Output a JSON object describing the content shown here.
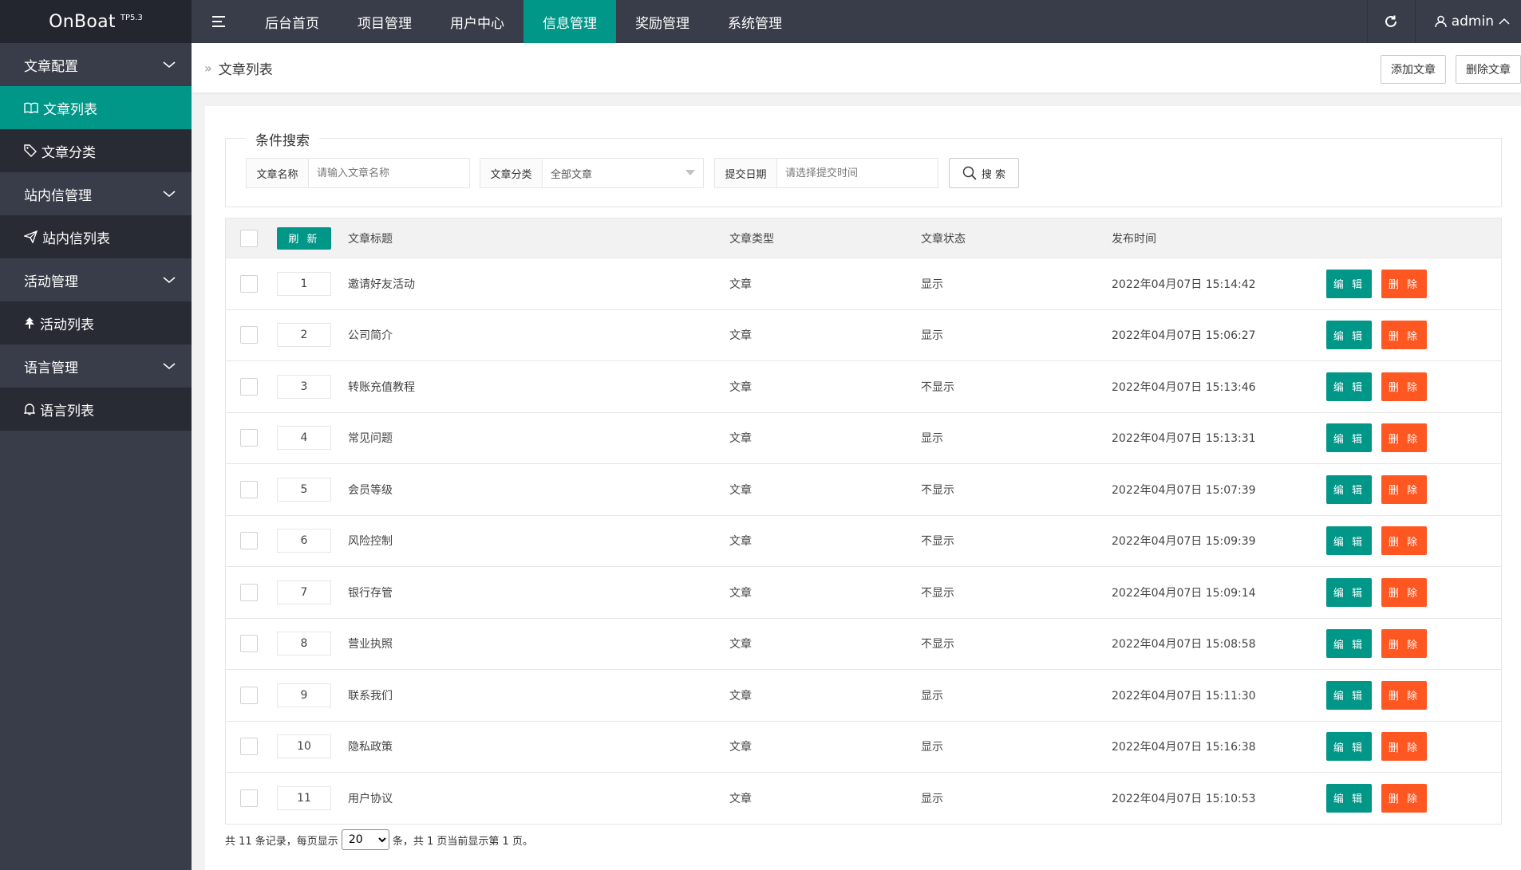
{
  "brand": {
    "name": "OnBoat",
    "version": "TP5.3"
  },
  "top_nav": [
    {
      "label": "后台首页"
    },
    {
      "label": "项目管理"
    },
    {
      "label": "用户中心"
    },
    {
      "label": "信息管理",
      "active": true
    },
    {
      "label": "奖励管理"
    },
    {
      "label": "系统管理"
    }
  ],
  "user": {
    "name": "admin"
  },
  "sidebar": {
    "groups": [
      {
        "label": "文章配置",
        "items": [
          {
            "label": "文章列表",
            "icon": "book-icon",
            "active": true
          },
          {
            "label": "文章分类",
            "icon": "tag-icon"
          }
        ]
      },
      {
        "label": "站内信管理",
        "items": [
          {
            "label": "站内信列表",
            "icon": "send-icon"
          }
        ]
      },
      {
        "label": "活动管理",
        "items": [
          {
            "label": "活动列表",
            "icon": "tree-icon"
          }
        ]
      },
      {
        "label": "语言管理",
        "items": [
          {
            "label": "语言列表",
            "icon": "bell-icon"
          }
        ]
      }
    ]
  },
  "breadcrumb": {
    "sep": "»",
    "current": "文章列表"
  },
  "actions": {
    "add": "添加文章",
    "delete": "删除文章"
  },
  "search": {
    "legend": "条件搜索",
    "name_label": "文章名称",
    "name_placeholder": "请输入文章名称",
    "category_label": "文章分类",
    "category_value": "全部文章",
    "date_label": "提交日期",
    "date_placeholder": "请选择提交时间",
    "button": "搜 索"
  },
  "table": {
    "refresh": "刷 新",
    "headers": {
      "title": "文章标题",
      "type": "文章类型",
      "status": "文章状态",
      "time": "发布时间"
    },
    "edit_label": "编 辑",
    "delete_label": "删 除",
    "rows": [
      {
        "id": "1",
        "title": "邀请好友活动",
        "type": "文章",
        "status": "显示",
        "on": true,
        "time": "2022年04月07日 15:14:42"
      },
      {
        "id": "2",
        "title": "公司简介",
        "type": "文章",
        "status": "显示",
        "on": true,
        "time": "2022年04月07日 15:06:27"
      },
      {
        "id": "3",
        "title": "转账充值教程",
        "type": "文章",
        "status": "不显示",
        "on": false,
        "time": "2022年04月07日 15:13:46"
      },
      {
        "id": "4",
        "title": "常见问题",
        "type": "文章",
        "status": "显示",
        "on": true,
        "time": "2022年04月07日 15:13:31"
      },
      {
        "id": "5",
        "title": "会员等级",
        "type": "文章",
        "status": "不显示",
        "on": false,
        "time": "2022年04月07日 15:07:39"
      },
      {
        "id": "6",
        "title": "风险控制",
        "type": "文章",
        "status": "不显示",
        "on": false,
        "time": "2022年04月07日 15:09:39"
      },
      {
        "id": "7",
        "title": "银行存管",
        "type": "文章",
        "status": "不显示",
        "on": false,
        "time": "2022年04月07日 15:09:14"
      },
      {
        "id": "8",
        "title": "营业执照",
        "type": "文章",
        "status": "不显示",
        "on": false,
        "time": "2022年04月07日 15:08:58"
      },
      {
        "id": "9",
        "title": "联系我们",
        "type": "文章",
        "status": "显示",
        "on": true,
        "time": "2022年04月07日 15:11:30"
      },
      {
        "id": "10",
        "title": "隐私政策",
        "type": "文章",
        "status": "显示",
        "on": true,
        "time": "2022年04月07日 15:16:38"
      },
      {
        "id": "11",
        "title": "用户协议",
        "type": "文章",
        "status": "显示",
        "on": true,
        "time": "2022年04月07日 15:10:53"
      }
    ]
  },
  "pager": {
    "prefix": "共 11 条记录，每页显示",
    "per_page": "20",
    "suffix": "条，共 1 页当前显示第 1 页。"
  },
  "colors": {
    "accent": "#009688",
    "danger": "#ff5722",
    "sidebar": "#393d49",
    "status_on": "#22a51b"
  }
}
